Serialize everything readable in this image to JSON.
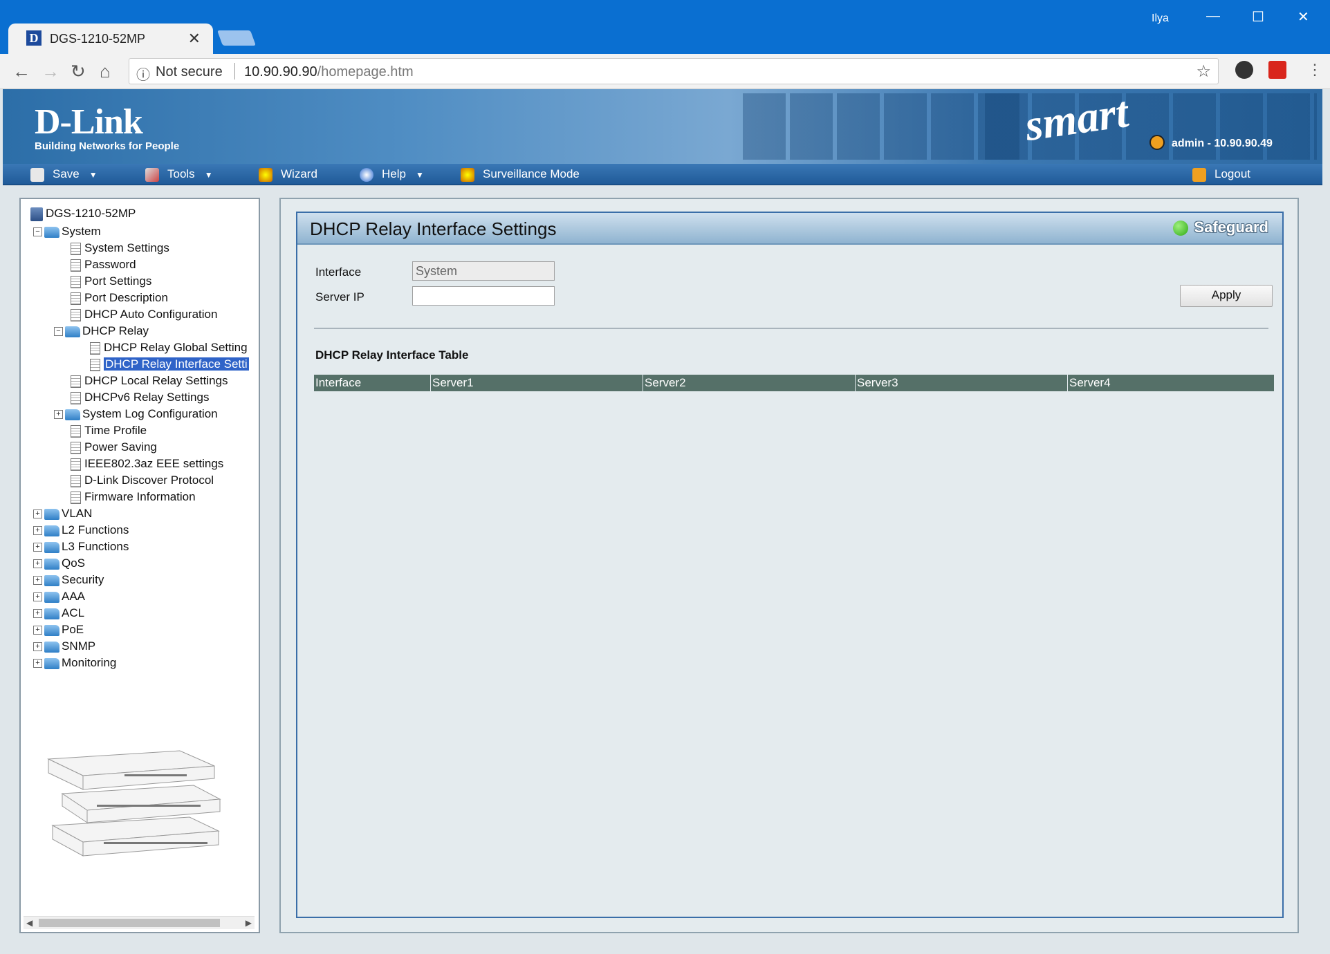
{
  "browser": {
    "tab_title": "DGS-1210-52MP",
    "tab_favicon": "D",
    "profile": "Ilya",
    "security": "Not secure",
    "url_host": "10.90.90.90",
    "url_path": "/homepage.htm"
  },
  "header": {
    "brand": "D-Link",
    "tagline": "Building Networks for People",
    "product_line": "smart",
    "user_info": "admin - 10.90.90.49"
  },
  "menu": {
    "save": "Save",
    "tools": "Tools",
    "wizard": "Wizard",
    "help": "Help",
    "surveillance": "Surveillance Mode",
    "logout": "Logout"
  },
  "tree": {
    "root": "DGS-1210-52MP",
    "system": "System",
    "system_settings": "System Settings",
    "password": "Password",
    "port_settings": "Port Settings",
    "port_description": "Port Description",
    "dhcp_auto": "DHCP Auto Configuration",
    "dhcp_relay": "DHCP Relay",
    "dhcp_relay_global": "DHCP Relay Global Setting",
    "dhcp_relay_interface": "DHCP Relay Interface Setti",
    "dhcp_local_relay": "DHCP Local Relay Settings",
    "dhcpv6_relay": "DHCPv6 Relay Settings",
    "system_log": "System Log Configuration",
    "time_profile": "Time Profile",
    "power_saving": "Power Saving",
    "eee": "IEEE802.3az EEE settings",
    "discover": "D-Link Discover Protocol",
    "firmware": "Firmware Information",
    "vlan": "VLAN",
    "l2": "L2 Functions",
    "l3": "L3 Functions",
    "qos": "QoS",
    "security": "Security",
    "aaa": "AAA",
    "acl": "ACL",
    "poe": "PoE",
    "snmp": "SNMP",
    "monitoring": "Monitoring"
  },
  "main": {
    "title": "DHCP Relay Interface Settings",
    "safeguard": "Safeguard",
    "interface_label": "Interface",
    "interface_value": "System",
    "server_ip_label": "Server IP",
    "server_ip_value": "",
    "apply": "Apply",
    "table_title": "DHCP Relay Interface Table",
    "columns": [
      "Interface",
      "Server1",
      "Server2",
      "Server3",
      "Server4"
    ]
  },
  "colors": {
    "chrome_blue": "#0a6fd1",
    "selected_node": "#2f63c8",
    "table_header": "#557068"
  }
}
